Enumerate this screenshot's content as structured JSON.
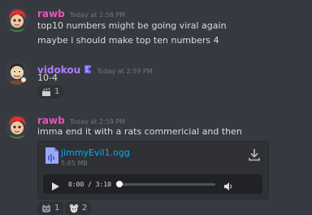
{
  "colors": {
    "background": "#36393f",
    "rawb_name": "#e754b8",
    "vidokou_name": "#b07cff",
    "link": "#00aff4",
    "timestamp": "#72767d",
    "text": "#dcddde"
  },
  "messages": [
    {
      "author": "rawb",
      "timestamp": "Today at 2:58 PM",
      "lines": [
        "top10 numbers might be going viral again",
        "maybe i should make top ten numbers 4"
      ]
    },
    {
      "author": "vidokou",
      "role_badge_icon": "server-booster-badge-icon",
      "timestamp": "Today at 2:59 PM",
      "lines": [
        "10-4"
      ],
      "reactions": [
        {
          "emoji_icon": "clapper-emoji-icon",
          "count": "1"
        }
      ]
    },
    {
      "author": "rawb",
      "timestamp": "Today at 2:59 PM",
      "lines": [
        "imma end it with a rats commericial and then"
      ],
      "attachment": {
        "file_name": "jimmyEvil1.ogg",
        "file_size": "5.65 MB",
        "file_icon": "audio-file-icon",
        "download_icon": "download-icon",
        "player": {
          "time": "0:00 / 3:10",
          "progress": 0.0,
          "play_icon": "play-icon",
          "volume_icon": "volume-icon"
        }
      },
      "reactions": [
        {
          "emoji_icon": "cat-face-emoji-icon",
          "count": "1"
        },
        {
          "emoji_icon": "mouse-face-emoji-icon",
          "count": "2"
        }
      ]
    }
  ]
}
